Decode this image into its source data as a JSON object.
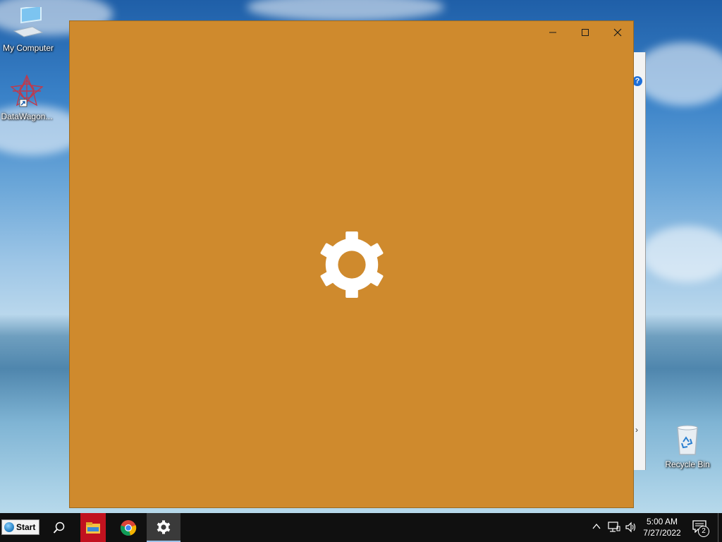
{
  "desktop": {
    "icons": [
      {
        "name": "my-computer",
        "label": "My Computer"
      },
      {
        "name": "datawagon",
        "label": "DataWagon..."
      },
      {
        "name": "recycle-bin",
        "label": "Recycle Bin"
      }
    ]
  },
  "window": {
    "background_color": "#cf8a2d",
    "splash_icon": "gear-icon",
    "caption_buttons": [
      "minimize-icon",
      "maximize-icon",
      "close-icon"
    ]
  },
  "taskbar": {
    "start_label": "Start",
    "apps": [
      "search-icon",
      "file-explorer-icon",
      "chrome-icon",
      "settings-icon"
    ],
    "clock_time": "5:00 AM",
    "clock_date": "7/27/2022",
    "notification_count": "2"
  }
}
